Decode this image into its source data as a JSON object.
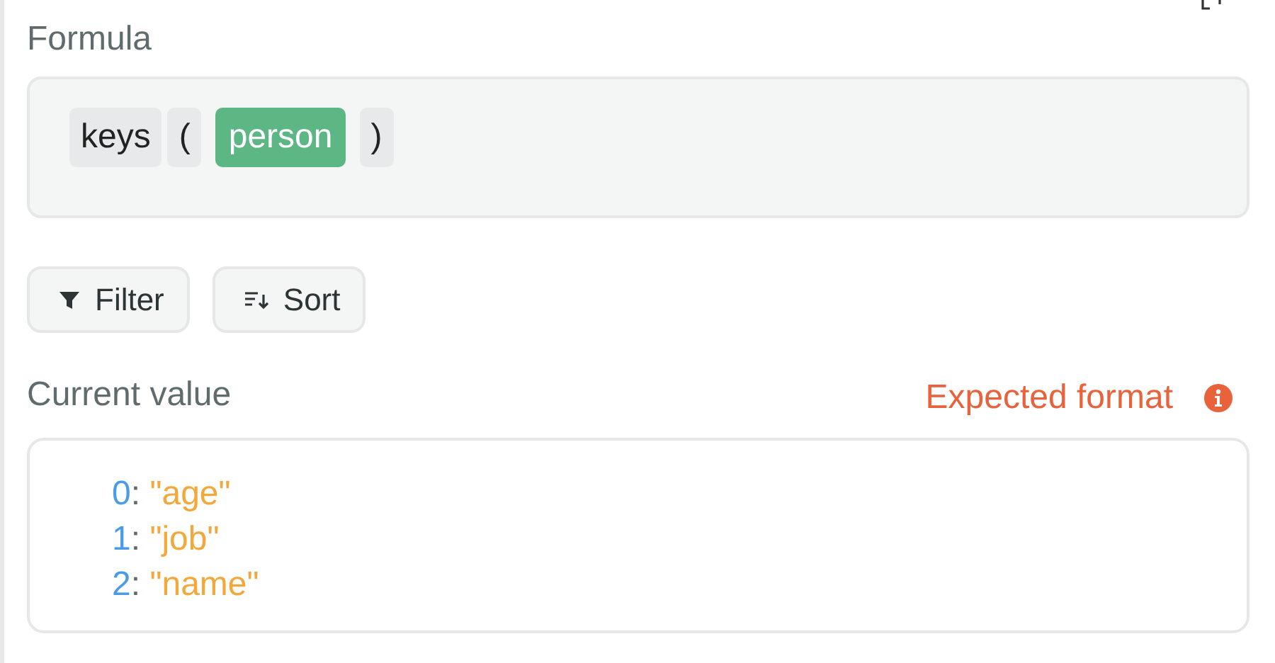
{
  "formula": {
    "label": "Formula",
    "tokens": [
      {
        "kind": "function",
        "text": "keys"
      },
      {
        "kind": "paren",
        "text": "("
      },
      {
        "kind": "variable",
        "text": "person"
      },
      {
        "kind": "paren",
        "text": ")"
      }
    ]
  },
  "buttons": [
    {
      "kind": "filter",
      "label": "Filter"
    },
    {
      "kind": "sort",
      "label": "Sort"
    }
  ],
  "current_value": {
    "label": "Current value",
    "warning": "Expected format",
    "entries": [
      {
        "key": "0",
        "separator": ":",
        "value": "\"age\""
      },
      {
        "key": "1",
        "separator": ":",
        "value": "\"job\""
      },
      {
        "key": "2",
        "separator": ":",
        "value": "\"name\""
      }
    ]
  }
}
